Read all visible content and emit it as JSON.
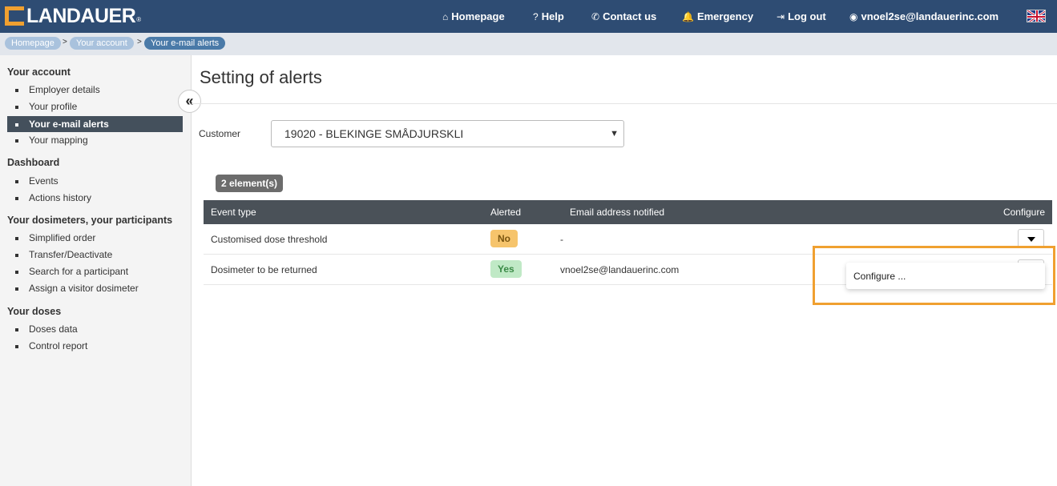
{
  "header": {
    "brand": "LANDAUER",
    "brand_reg": "®",
    "nav": [
      {
        "icon": "home-icon",
        "glyph": "⌂",
        "label": "Homepage"
      },
      {
        "icon": "help-icon",
        "glyph": "?",
        "label": "Help"
      },
      {
        "icon": "phone-icon",
        "glyph": "✆",
        "label": "Contact us"
      },
      {
        "icon": "bell-icon",
        "glyph": "🔔",
        "label": "Emergency"
      },
      {
        "icon": "logout-icon",
        "glyph": "⇥",
        "label": "Log out"
      },
      {
        "icon": "user-icon",
        "glyph": "◉",
        "label": "vnoel2se@landauerinc.com"
      }
    ],
    "language_flag": "uk-flag-icon"
  },
  "breadcrumb": [
    "Homepage",
    "Your account",
    "Your e-mail alerts"
  ],
  "sidebar": {
    "sections": [
      {
        "title": "Your account",
        "items": [
          "Employer details",
          "Your profile",
          "Your e-mail alerts",
          "Your mapping"
        ]
      },
      {
        "title": "Dashboard",
        "items": [
          "Events",
          "Actions history"
        ]
      },
      {
        "title": "Your dosimeters, your participants",
        "items": [
          "Simplified order",
          "Transfer/Deactivate",
          "Search for a participant",
          "Assign a visitor dosimeter"
        ]
      },
      {
        "title": "Your doses",
        "items": [
          "Doses data",
          "Control report"
        ]
      }
    ],
    "active_item": "Your e-mail alerts"
  },
  "main": {
    "title": "Setting of alerts",
    "customer_label": "Customer",
    "customer_value": "19020 - BLEKINGE SMÅDJURSKLI",
    "count_badge": "2 element(s)",
    "table": {
      "headers": [
        "Event type",
        "Alerted",
        "Email address notified",
        "Configure"
      ],
      "rows": [
        {
          "event": "Customised dose threshold",
          "alerted": "No",
          "email": "-"
        },
        {
          "event": "Dosimeter to be returned",
          "alerted": "Yes",
          "email": "vnoel2se@landauerinc.com"
        }
      ]
    },
    "dropdown_menu": [
      "Configure ..."
    ]
  },
  "colors": {
    "header_bg": "#2e4c73",
    "accent_orange": "#f0a030",
    "table_header_bg": "#4a5158",
    "alert_no": "#f6c46c",
    "alert_yes": "#c0e9c6"
  }
}
